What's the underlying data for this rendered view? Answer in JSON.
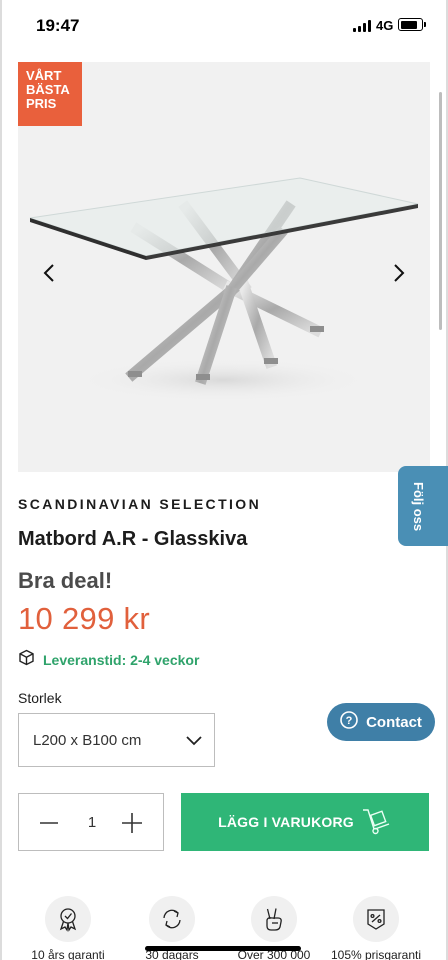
{
  "status_bar": {
    "time": "19:47",
    "network": "4G",
    "battery_level": 0.85
  },
  "gallery": {
    "badge_lines": [
      "VÅRT",
      "BÄSTA",
      "PRIS"
    ],
    "badge_color": "#e9603c",
    "prev_icon": "chevron-left-icon",
    "next_icon": "chevron-right-icon"
  },
  "product": {
    "brand": "SCANDINAVIAN SELECTION",
    "title": "Matbord A.R - Glasskiva",
    "deal_label": "Bra deal!",
    "price": "10 299 kr",
    "price_color": "#e1603c",
    "delivery": "Leveranstid: 2-4 veckor",
    "delivery_color": "#2fa36b",
    "delivery_icon": "box-icon"
  },
  "follow": {
    "label": "Följ oss"
  },
  "options": {
    "size_label": "Storlek",
    "size_value": "L200 x B100 cm"
  },
  "contact": {
    "label": "Contact",
    "icon": "question-circle-icon"
  },
  "purchase": {
    "quantity": "1",
    "add_to_cart_label": "LÄGG I VARUKORG",
    "cart_color": "#2fb677"
  },
  "features": [
    {
      "icon": "award-ribbon-icon",
      "label": "10 års garanti"
    },
    {
      "icon": "return-arrows-icon",
      "label": "30 dagars"
    },
    {
      "icon": "peace-hand-icon",
      "label": "Över 300 000"
    },
    {
      "icon": "percent-tag-icon",
      "label": "105% prisgaranti"
    }
  ]
}
